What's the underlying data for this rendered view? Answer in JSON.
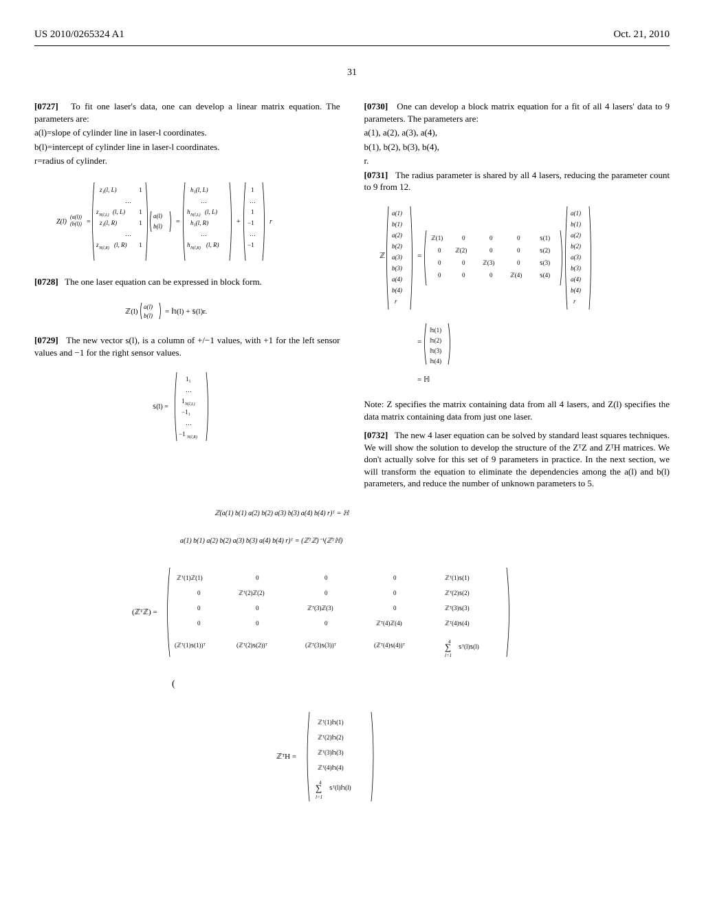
{
  "header": {
    "left": "US 2010/0265324 A1",
    "right": "Oct. 21, 2010"
  },
  "pageNumber": "31",
  "leftCol": {
    "p0727": {
      "num": "[0727]",
      "text": "To fit one laser's data, one can develop a linear matrix equation. The parameters are:"
    },
    "paramA": "a(l)=slope of cylinder line in laser-l coordinates.",
    "paramB": "b(l)=intercept of cylinder line in laser-l coordinates.",
    "paramR": "r=radius of cylinder.",
    "p0728": {
      "num": "[0728]",
      "text": "The one laser equation can be expressed in block form."
    },
    "p0729": {
      "num": "[0729]",
      "text": "The new vector s(l), is a column of +/−1 values, with +1 for the left sensor values and −1 for the right sensor values."
    }
  },
  "rightCol": {
    "p0730": {
      "num": "[0730]",
      "text": "One can develop a block matrix equation for a fit of all 4 lasers' data to 9 parameters. The parameters are:"
    },
    "params1": "a(1), a(2), a(3), a(4),",
    "params2": "b(1), b(2), b(3), b(4),",
    "params3": "r.",
    "p0731": {
      "num": "[0731]",
      "text": "The radius parameter is shared by all 4 lasers, reducing the parameter count to 9 from 12."
    },
    "note": "Note: Z specifies the matrix containing data from all 4 lasers, and Z(l) specifies the data matrix containing data from just one laser.",
    "p0732": {
      "num": "[0732]",
      "text": "The new 4 laser equation can be solved by standard least squares techniques. We will show the solution to develop the structure of the ZᵀZ and ZᵀH matrices. We don't actually solve for this set of 9 parameters in practice. In the next section, we will transform the equation to eliminate the dependencies among the a(l) and b(l) parameters, and reduce the number of unknown parameters to 5."
    }
  },
  "equations": {
    "eq1_label": "Z(l)",
    "block_form": "ℤ(l)(a(l); b(l)) = 𝕙(l) + 𝕤(l)r.",
    "row_eq1": "ℤ(a(1)  b(1)  a(2)  b(2)  a(3)  b(3)  a(4)  b(4) r)ᵀ = ℍ",
    "row_eq2": "a(1)  b(1)  a(2)  b(2)  a(3)  b(3)  a(4)  b(4)  r)ᵀ = (ℤᵀℤ)⁻¹(ℤᵀℍ)"
  }
}
